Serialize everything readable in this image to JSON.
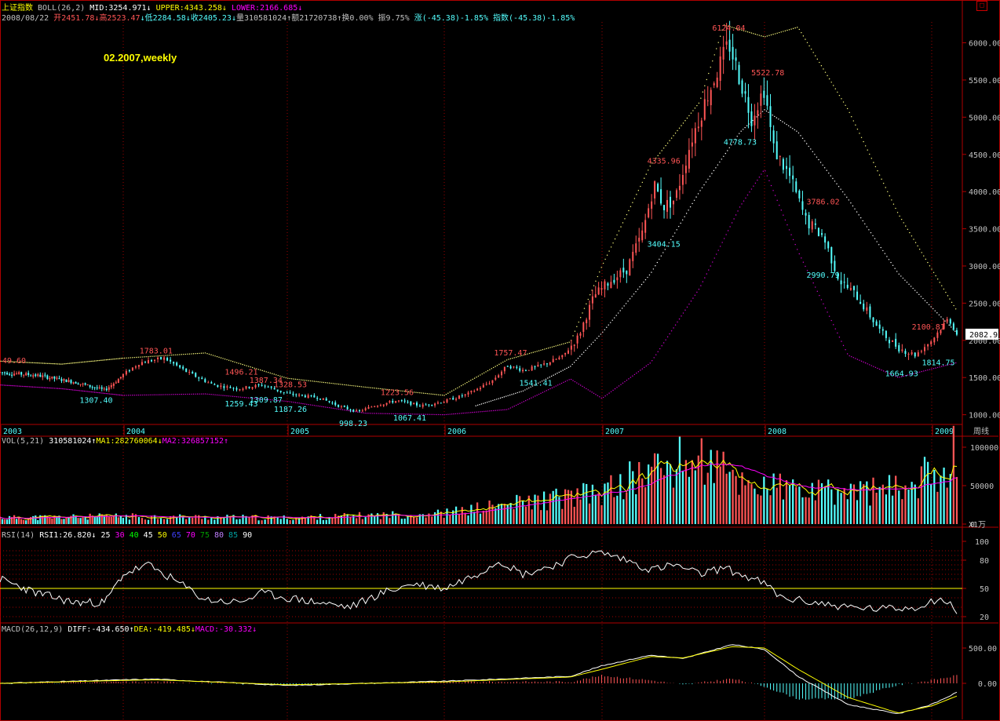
{
  "header": {
    "index_name": "上证指数",
    "boll_label": "BOLL(26,2)",
    "mid": "MID:3254.971",
    "upper": "UPPER:4343.258",
    "lower": "LOWER:2166.685",
    "date": "2008/08/22",
    "open": "开2451.78",
    "high": "高2523.47",
    "low": "低2284.58",
    "close": "收2405.23",
    "volume": "量310581024",
    "amount": "额21720738",
    "turnover": "换0.00%",
    "amplitude": "振9.75%",
    "change": "涨(-45.38)-1.85%",
    "index_change": "指数(-45.38)-1.85%"
  },
  "annotation": "02.2007,weekly",
  "period_label": "周线",
  "current_price_tag": "2082.9",
  "colors": {
    "up": "#ff5555",
    "down": "#54ffff",
    "frame": "#b00000",
    "upper_band": "#ffff80",
    "lower_band": "#d000d0",
    "mid_band": "#ffffff",
    "yellow": "#ffff00",
    "magenta": "#ff00ff"
  },
  "chart_data": [
    {
      "type": "candlestick",
      "title": "上证指数 BOLL(26,2)",
      "x_ticks": [
        "2003",
        "2004",
        "2005",
        "2006",
        "2007",
        "2008",
        "2009"
      ],
      "y_ticks": [
        1000,
        1500,
        2000,
        2500,
        3000,
        3500,
        4000,
        4500,
        5000,
        5500,
        6000
      ],
      "ylim": [
        880,
        6280
      ],
      "grid": "vertical dotted at year boundaries",
      "labeled_points": [
        {
          "label": "49.60",
          "value": 1649.6,
          "kind": "high"
        },
        {
          "label": "1307.40",
          "value": 1307.4,
          "kind": "low"
        },
        {
          "label": "1783.01",
          "value": 1783.01,
          "kind": "high"
        },
        {
          "label": "1496.21",
          "value": 1496.21,
          "kind": "high"
        },
        {
          "label": "1259.43",
          "value": 1259.43,
          "kind": "low"
        },
        {
          "label": "1387.34",
          "value": 1387.34,
          "kind": "high"
        },
        {
          "label": "1309.87",
          "value": 1309.87,
          "kind": "low"
        },
        {
          "label": "1328.53",
          "value": 1328.53,
          "kind": "high"
        },
        {
          "label": "1187.26",
          "value": 1187.26,
          "kind": "low"
        },
        {
          "label": "998.23",
          "value": 998.23,
          "kind": "low"
        },
        {
          "label": "1223.56",
          "value": 1223.56,
          "kind": "high"
        },
        {
          "label": "1067.41",
          "value": 1067.41,
          "kind": "low"
        },
        {
          "label": "1757.47",
          "value": 1757.47,
          "kind": "high"
        },
        {
          "label": "1541.41",
          "value": 1541.41,
          "kind": "low"
        },
        {
          "label": "4335.96",
          "value": 4335.96,
          "kind": "high"
        },
        {
          "label": "3404.15",
          "value": 3404.15,
          "kind": "low"
        },
        {
          "label": "6124.04",
          "value": 6124.04,
          "kind": "high"
        },
        {
          "label": "4778.73",
          "value": 4778.73,
          "kind": "low"
        },
        {
          "label": "5522.78",
          "value": 5522.78,
          "kind": "high"
        },
        {
          "label": "3786.02",
          "value": 3786.02,
          "kind": "high"
        },
        {
          "label": "2990.79",
          "value": 2990.79,
          "kind": "low"
        },
        {
          "label": "1664.93",
          "value": 1664.93,
          "kind": "low"
        },
        {
          "label": "2100.81",
          "value": 2100.81,
          "kind": "high"
        },
        {
          "label": "1814.75",
          "value": 1814.75,
          "kind": "low"
        }
      ],
      "close_trend": [
        [
          2003.0,
          1570
        ],
        [
          2003.3,
          1530
        ],
        [
          2003.6,
          1440
        ],
        [
          2003.85,
          1330
        ],
        [
          2003.95,
          1460
        ],
        [
          2004.1,
          1700
        ],
        [
          2004.25,
          1760
        ],
        [
          2004.4,
          1560
        ],
        [
          2004.55,
          1400
        ],
        [
          2004.7,
          1350
        ],
        [
          2004.85,
          1400
        ],
        [
          2005.0,
          1280
        ],
        [
          2005.2,
          1230
        ],
        [
          2005.35,
          1100
        ],
        [
          2005.45,
          1040
        ],
        [
          2005.55,
          1120
        ],
        [
          2005.7,
          1190
        ],
        [
          2005.85,
          1120
        ],
        [
          2006.0,
          1180
        ],
        [
          2006.15,
          1280
        ],
        [
          2006.3,
          1450
        ],
        [
          2006.4,
          1660
        ],
        [
          2006.5,
          1600
        ],
        [
          2006.6,
          1650
        ],
        [
          2006.75,
          1780
        ],
        [
          2006.85,
          2050
        ],
        [
          2006.95,
          2600
        ],
        [
          2007.05,
          2800
        ],
        [
          2007.15,
          2950
        ],
        [
          2007.25,
          3450
        ],
        [
          2007.32,
          4100
        ],
        [
          2007.38,
          3800
        ],
        [
          2007.45,
          3900
        ],
        [
          2007.55,
          4700
        ],
        [
          2007.65,
          5300
        ],
        [
          2007.78,
          6000
        ],
        [
          2007.85,
          5500
        ],
        [
          2007.92,
          5000
        ],
        [
          2008.0,
          5400
        ],
        [
          2008.05,
          4600
        ],
        [
          2008.15,
          4200
        ],
        [
          2008.25,
          3600
        ],
        [
          2008.35,
          3400
        ],
        [
          2008.45,
          2800
        ],
        [
          2008.55,
          2600
        ],
        [
          2008.7,
          2100
        ],
        [
          2008.8,
          1900
        ],
        [
          2008.9,
          1800
        ],
        [
          2009.0,
          2000
        ],
        [
          2009.1,
          2300
        ],
        [
          2009.15,
          2082.9
        ]
      ],
      "upper_band": [
        [
          2003.0,
          1720
        ],
        [
          2003.5,
          1680
        ],
        [
          2004.0,
          1760
        ],
        [
          2004.5,
          1830
        ],
        [
          2005.0,
          1490
        ],
        [
          2005.5,
          1370
        ],
        [
          2006.0,
          1260
        ],
        [
          2006.4,
          1740
        ],
        [
          2006.8,
          1980
        ],
        [
          2007.0,
          3000
        ],
        [
          2007.3,
          4360
        ],
        [
          2007.6,
          5200
        ],
        [
          2007.75,
          6240
        ],
        [
          2008.0,
          6080
        ],
        [
          2008.2,
          6210
        ],
        [
          2008.5,
          5100
        ],
        [
          2008.8,
          3700
        ],
        [
          2009.15,
          2400
        ]
      ],
      "mid_band": [
        [
          2006.2,
          1120
        ],
        [
          2006.5,
          1320
        ],
        [
          2006.8,
          1650
        ],
        [
          2007.0,
          2100
        ],
        [
          2007.3,
          2900
        ],
        [
          2007.6,
          4000
        ],
        [
          2007.85,
          4800
        ],
        [
          2008.0,
          5100
        ],
        [
          2008.2,
          4800
        ],
        [
          2008.5,
          3900
        ],
        [
          2008.8,
          2900
        ],
        [
          2009.15,
          2100
        ]
      ],
      "lower_band": [
        [
          2003.0,
          1400
        ],
        [
          2003.5,
          1350
        ],
        [
          2004.0,
          1260
        ],
        [
          2004.5,
          1280
        ],
        [
          2005.0,
          1180
        ],
        [
          2005.5,
          1020
        ],
        [
          2006.0,
          1000
        ],
        [
          2006.4,
          1070
        ],
        [
          2006.8,
          1480
        ],
        [
          2007.0,
          1220
        ],
        [
          2007.3,
          1700
        ],
        [
          2007.6,
          2700
        ],
        [
          2007.85,
          3800
        ],
        [
          2008.0,
          4300
        ],
        [
          2008.2,
          3200
        ],
        [
          2008.5,
          1800
        ],
        [
          2008.8,
          1500
        ],
        [
          2009.15,
          1700
        ]
      ]
    },
    {
      "type": "bar",
      "title": "VOL(5,21)",
      "value_label": "310581024",
      "ma1_label": "MA1:282760064",
      "ma2_label": "MA2:326857152",
      "unit_label": "X1万",
      "y_ticks": [
        0,
        50000,
        100000
      ],
      "ylim": [
        0,
        100000
      ],
      "volume_trend": [
        [
          2003.0,
          8000
        ],
        [
          2004.0,
          10000
        ],
        [
          2005.0,
          8000
        ],
        [
          2006.0,
          14000
        ],
        [
          2006.5,
          28000
        ],
        [
          2007.0,
          40000
        ],
        [
          2007.3,
          70000
        ],
        [
          2007.6,
          85000
        ],
        [
          2007.85,
          55000
        ],
        [
          2008.3,
          40000
        ],
        [
          2008.8,
          45000
        ],
        [
          2009.0,
          65000
        ],
        [
          2009.15,
          95000
        ]
      ]
    },
    {
      "type": "line",
      "title": "RSI(14)",
      "value_label": "RSI1:26.820",
      "levels": [
        "25",
        "30",
        "40",
        "45",
        "50",
        "65",
        "70",
        "75",
        "80",
        "85",
        "90"
      ],
      "level_colors": [
        "#ffffff",
        "#ff00ff",
        "#00ff00",
        "#ffffff",
        "#ffff00",
        "#4040ff",
        "#ff00ff",
        "#00a000",
        "#c080ff",
        "#00a0a0",
        "#ffffff"
      ],
      "y_ticks": [
        20,
        50,
        80,
        100
      ],
      "ylim": [
        15,
        100
      ],
      "rsi_trend": [
        [
          2003.0,
          60
        ],
        [
          2003.3,
          45
        ],
        [
          2003.6,
          35
        ],
        [
          2003.85,
          35
        ],
        [
          2004.0,
          65
        ],
        [
          2004.15,
          75
        ],
        [
          2004.3,
          60
        ],
        [
          2004.5,
          38
        ],
        [
          2004.7,
          35
        ],
        [
          2004.85,
          45
        ],
        [
          2005.0,
          40
        ],
        [
          2005.2,
          35
        ],
        [
          2005.4,
          30
        ],
        [
          2005.6,
          45
        ],
        [
          2005.8,
          55
        ],
        [
          2006.0,
          50
        ],
        [
          2006.2,
          65
        ],
        [
          2006.35,
          80
        ],
        [
          2006.5,
          65
        ],
        [
          2006.7,
          75
        ],
        [
          2006.85,
          85
        ],
        [
          2007.0,
          88
        ],
        [
          2007.15,
          80
        ],
        [
          2007.3,
          70
        ],
        [
          2007.45,
          75
        ],
        [
          2007.6,
          65
        ],
        [
          2007.75,
          72
        ],
        [
          2007.85,
          65
        ],
        [
          2008.0,
          55
        ],
        [
          2008.1,
          40
        ],
        [
          2008.3,
          35
        ],
        [
          2008.5,
          30
        ],
        [
          2008.7,
          28
        ],
        [
          2008.9,
          30
        ],
        [
          2009.05,
          40
        ],
        [
          2009.15,
          26.8
        ]
      ]
    },
    {
      "type": "line",
      "title": "MACD(26,12,9)",
      "diff_label": "DIFF:-434.650",
      "dea_label": "DEA:-419.485",
      "macd_label": "MACD:-30.332",
      "y_ticks": [
        500,
        0
      ],
      "ylim": [
        -500,
        700
      ],
      "diff_trend": [
        [
          2003.0,
          0
        ],
        [
          2004.2,
          60
        ],
        [
          2005.0,
          -30
        ],
        [
          2006.0,
          30
        ],
        [
          2006.8,
          100
        ],
        [
          2007.0,
          250
        ],
        [
          2007.3,
          400
        ],
        [
          2007.5,
          350
        ],
        [
          2007.8,
          550
        ],
        [
          2008.0,
          480
        ],
        [
          2008.2,
          100
        ],
        [
          2008.5,
          -300
        ],
        [
          2008.8,
          -430
        ],
        [
          2009.0,
          -300
        ],
        [
          2009.15,
          -130
        ]
      ],
      "dea_trend": [
        [
          2003.0,
          0
        ],
        [
          2004.2,
          50
        ],
        [
          2005.0,
          -20
        ],
        [
          2006.0,
          20
        ],
        [
          2006.8,
          90
        ],
        [
          2007.0,
          200
        ],
        [
          2007.3,
          380
        ],
        [
          2007.5,
          360
        ],
        [
          2007.8,
          520
        ],
        [
          2008.0,
          500
        ],
        [
          2008.2,
          200
        ],
        [
          2008.5,
          -200
        ],
        [
          2008.8,
          -420
        ],
        [
          2009.0,
          -320
        ],
        [
          2009.15,
          -180
        ]
      ]
    }
  ]
}
